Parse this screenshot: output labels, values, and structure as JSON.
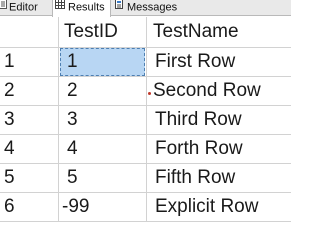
{
  "tabs": [
    {
      "label": "Editor",
      "icon": "editor-icon"
    },
    {
      "label": "Results",
      "icon": "grid-icon"
    },
    {
      "label": "Messages",
      "icon": "messages-icon"
    }
  ],
  "grid": {
    "columns": [
      "TestID",
      "TestName"
    ],
    "rows": [
      {
        "num": "1",
        "id": "1",
        "name": "First Row"
      },
      {
        "num": "2",
        "id": "2",
        "name": "Second Row"
      },
      {
        "num": "3",
        "id": "3",
        "name": "Third Row"
      },
      {
        "num": "4",
        "id": "4",
        "name": "Forth Row"
      },
      {
        "num": "5",
        "id": "5",
        "name": "Fifth Row"
      },
      {
        "num": "6",
        "id": "-99",
        "name": "Explicit Row"
      }
    ],
    "selected_cell": {
      "row": 1,
      "column": "TestID"
    }
  },
  "colors": {
    "selection": "#b8d6f3",
    "gridline": "#d2d2d2",
    "marker": "#c0392b"
  }
}
